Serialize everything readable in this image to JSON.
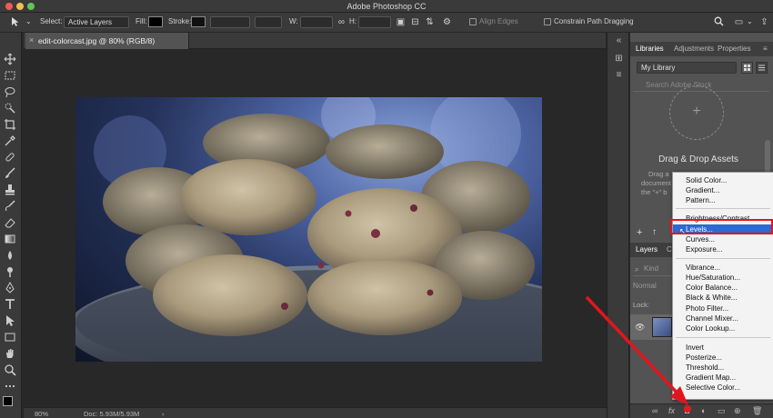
{
  "window": {
    "title": "Adobe Photoshop CC"
  },
  "options_bar": {
    "select_label": "Select:",
    "select_value": "Active Layers",
    "fill_label": "Fill:",
    "stroke_label": "Stroke:",
    "w_label": "W:",
    "h_label": "H:",
    "align_edges": "Align Edges",
    "constrain_label": "Constrain Path Dragging"
  },
  "document": {
    "tab_title": "edit-colorcast.jpg @ 80% (RGB/8)",
    "tab_close": "×"
  },
  "status_bar": {
    "zoom": "80%",
    "doc_size": "Doc: 5.93M/5.93M",
    "arrow": "›"
  },
  "panels": {
    "tabs": [
      "Libraries",
      "Adjustments",
      "Properties"
    ],
    "library_select": "My Library",
    "search_placeholder": "Search Adobe Stock",
    "dropzone_symbol": "+",
    "drag_drop_title": "Drag & Drop Assets",
    "drag_drop_desc": [
      "Drag a",
      "document",
      "the \"+\" b"
    ],
    "footer_icons": [
      "+",
      "↑"
    ],
    "layers_tabs": [
      "Layers",
      "C"
    ],
    "kind_placeholder": "Kind",
    "blend_mode": "Normal",
    "lock_label": "Lock:",
    "layers_footer_icons": [
      "∞",
      "fx",
      "◘",
      "◐",
      "▭",
      "⊕",
      "🗑"
    ]
  },
  "context_menu": {
    "groups": [
      [
        "Solid Color...",
        "Gradient...",
        "Pattern..."
      ],
      [
        "Brightness/Contrast...",
        "Levels...",
        "Curves...",
        "Exposure..."
      ],
      [
        "Vibrance...",
        "Hue/Saturation...",
        "Color Balance...",
        "Black & White...",
        "Photo Filter...",
        "Channel Mixer...",
        "Color Lookup..."
      ],
      [
        "Invert",
        "Posterize...",
        "Threshold...",
        "Gradient Map...",
        "Selective Color..."
      ]
    ],
    "highlighted": "Levels..."
  },
  "colors": {
    "highlight": "#2e69d1",
    "annotation_red": "#e0161e"
  }
}
